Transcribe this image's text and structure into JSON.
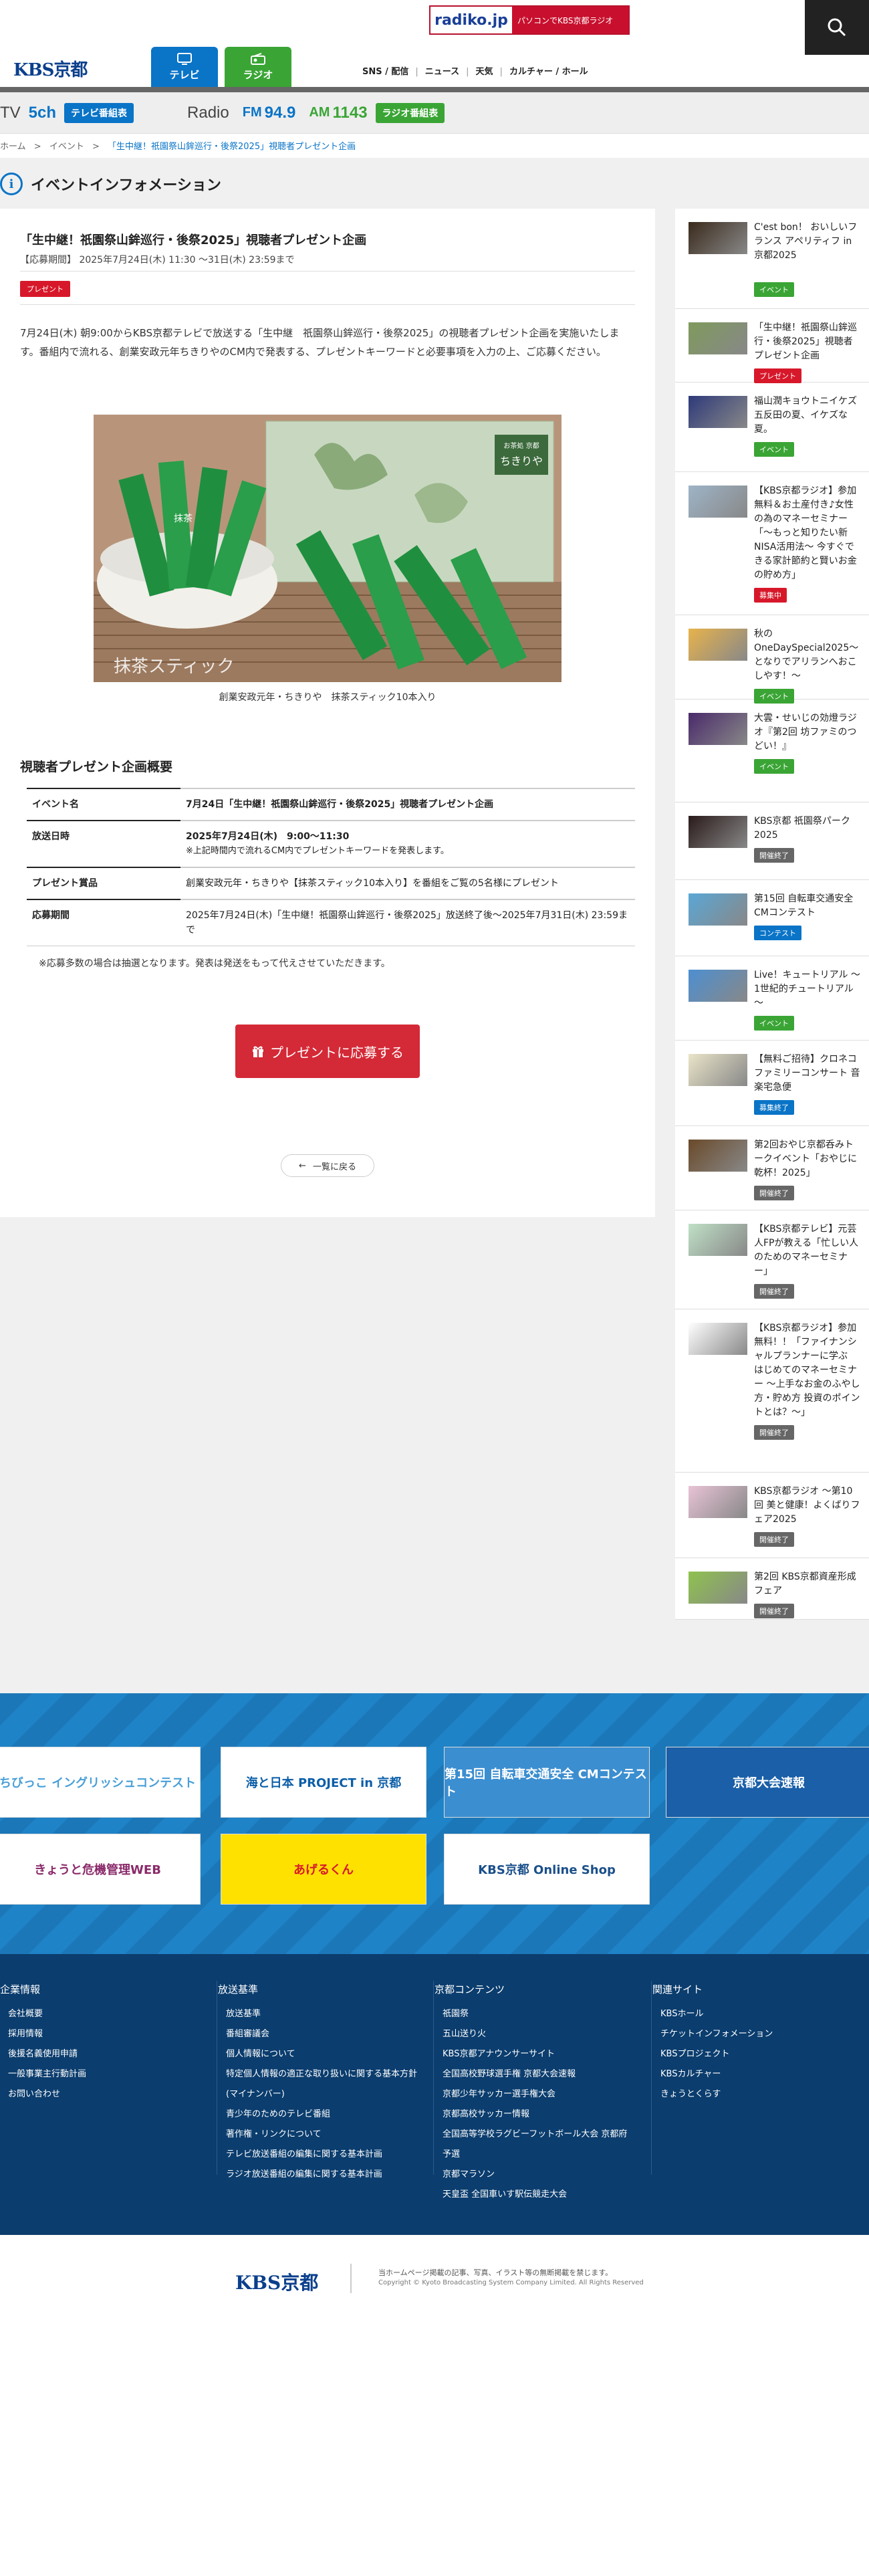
{
  "header": {
    "logo": "KBS京都",
    "radiko_logo": "radiko.jp",
    "radiko_text": "パソコンでKBS京都ラジオ",
    "tab_tv": "テレビ",
    "tab_radio": "ラジオ",
    "nav": [
      "SNS / 配信",
      "ニュース",
      "天気",
      "カルチャー / ホール"
    ]
  },
  "channels": {
    "tv_label": "TV",
    "tv_ch": "5ch",
    "tv_button": "テレビ番組表",
    "radio_label": "Radio",
    "fm_label": "FM",
    "fm_value": "94.9",
    "am_label": "AM",
    "am_value": "1143",
    "radio_button": "ラジオ番組表"
  },
  "breadcrumb": [
    "ホーム",
    "イベント",
    "「生中継！祇園祭山鉾巡行・後祭2025」視聴者プレゼント企画"
  ],
  "page_title": "イベントインフォメーション",
  "article": {
    "title": "「生中継！祇園祭山鉾巡行・後祭2025」視聴者プレゼント企画",
    "period": "【応募期間】 2025年7月24日(木) 11:30 ～31日(木) 23:59まで",
    "badge": "プレゼント",
    "body": "7月24日(木) 朝9:00からKBS京都テレビで放送する「生中継　祇園祭山鉾巡行・後祭2025」の視聴者プレゼント企画を実施いたします。番組内で流れる、創業安政元年ちきりやのCM内で発表する、プレゼントキーワードと必要事項を入力の上、ご応募ください。",
    "image_box_brand": "お茶処 京都",
    "image_box_name": "ちきりや",
    "image_overlay": "抹茶スティック",
    "stick_text": "抹茶",
    "caption": "創業安政元年・ちきりや　抹茶スティック10本入り",
    "summary_heading": "視聴者プレゼント企画概要",
    "table": [
      {
        "key": "イベント名",
        "value": "7月24日「生中継！祇園祭山鉾巡行・後祭2025」視聴者プレゼント企画",
        "sub": ""
      },
      {
        "key": "放送日時",
        "value": "2025年7月24日(木)　9:00～11:30",
        "sub": "※上記時間内で流れるCM内でプレゼントキーワードを発表します。"
      },
      {
        "key": "プレゼント賞品",
        "value": "創業安政元年・ちきりや【抹茶スティック10本入り】を番組をご覧の5名様にプレゼント",
        "sub": ""
      },
      {
        "key": "応募期間",
        "value": "2025年7月24日(木)「生中継！祇園祭山鉾巡行・後祭2025」放送終了後～2025年7月31日(木) 23:59まで",
        "sub": ""
      }
    ],
    "note": "※応募多数の場合は抽選となります。発表は発送をもって代えさせていただきます。",
    "apply_button": "プレゼントに応募する",
    "back_button": "一覧に戻る"
  },
  "sidebar": [
    {
      "title": "C'est bon！ おいしいフランス アペリティフ in 京都2025",
      "badge": "イベント",
      "badge_color": "#3aa535",
      "thumb": "#3a2a1c"
    },
    {
      "title": "「生中継！祇園祭山鉾巡行・後祭2025」視聴者プレゼント企画",
      "badge": "プレゼント",
      "badge_color": "#d7182a",
      "thumb": "#7f9a5c"
    },
    {
      "title": "福山潤キョウトニイケズ　五反田の夏、イケズな夏。",
      "badge": "イベント",
      "badge_color": "#3aa535",
      "thumb": "#2e3a7a"
    },
    {
      "title": "【KBS京都ラジオ】参加無料＆お土産付き♪女性の為のマネーセミナー「～もっと知りたい新NISA活用法～ 今すぐできる家計節約と賢いお金の貯め方」",
      "badge": "募集中",
      "badge_color": "#d7182a",
      "thumb": "#9eb4c7"
    },
    {
      "title": "秋のOneDaySpecial2025～となりでアリランへおこしやす！～",
      "badge": "イベント",
      "badge_color": "#3aa535",
      "thumb": "#e7b34c"
    },
    {
      "title": "大雲・せいじの効燈ラジオ『第2回 坊ファミのつどい！』",
      "badge": "イベント",
      "badge_color": "#3aa535",
      "thumb": "#4a2a6a"
    },
    {
      "title": "KBS京都 祇園祭パーク2025",
      "badge": "開催終了",
      "badge_color": "#666666",
      "thumb": "#2a1a1a"
    },
    {
      "title": "第15回 自転車交通安全CMコンテスト",
      "badge": "コンテスト",
      "badge_color": "#0a74c7",
      "thumb": "#5aa7d6"
    },
    {
      "title": "Live！キュートリアル ～1世紀的チュートリアル～",
      "badge": "イベント",
      "badge_color": "#3aa535",
      "thumb": "#4c8fd1"
    },
    {
      "title": "【無料ご招待】クロネコファミリーコンサート 音楽宅急便",
      "badge": "募集終了",
      "badge_color": "#0a74c7",
      "thumb": "#e9e4c8"
    },
    {
      "title": "第2回おやじ京都呑みトークイベント「おやじに乾杯！2025」",
      "badge": "開催終了",
      "badge_color": "#666666",
      "thumb": "#6a4a2a"
    },
    {
      "title": "【KBS京都テレビ】元芸人FPが教える「忙しい人のためのマネーセミナー」",
      "badge": "開催終了",
      "badge_color": "#666666",
      "thumb": "#bfe0c6"
    },
    {
      "title": "【KBS京都ラジオ】参加無料！！「ファイナンシャルプランナーに学ぶ　はじめてのマネーセミナー ～上手なお金のふやし方・貯め方 投資のポイントとは？～」",
      "badge": "開催終了",
      "badge_color": "#666666",
      "thumb": "#ffffff"
    },
    {
      "title": "KBS京都ラジオ ～第10回 美と健康！よくばりフェア2025",
      "badge": "開催終了",
      "badge_color": "#666666",
      "thumb": "#e8c3d6"
    },
    {
      "title": "第2回 KBS京都資産形成フェア",
      "badge": "開催終了",
      "badge_color": "#666666",
      "thumb": "#8fc24e"
    }
  ],
  "banners": [
    {
      "name": "ちびっこ イングリッシュコンテスト",
      "bg": "#ffffff",
      "fg": "#4a9fd8"
    },
    {
      "name": "海と日本 PROJECT in 京都",
      "bg": "#ffffff",
      "fg": "#0b5ea8"
    },
    {
      "name": "第15回 自転車交通安全 CMコンテスト",
      "bg": "#3b8ed0",
      "fg": "#ffffff"
    },
    {
      "name": "京都大会速報",
      "bg": "#1a5fa8",
      "fg": "#ffffff"
    },
    {
      "name": "きょうと危機管理WEB",
      "bg": "#ffffff",
      "fg": "#8a2a6a"
    },
    {
      "name": "あげるくん",
      "bg": "#ffe100",
      "fg": "#d7182a"
    },
    {
      "name": "KBS京都 Online Shop",
      "bg": "#ffffff",
      "fg": "#1a4f8a"
    }
  ],
  "footer": {
    "cols": [
      {
        "heading": "企業情報",
        "items": [
          "会社概要",
          "採用情報",
          "後援名義使用申請",
          "一般事業主行動計画",
          "お問い合わせ"
        ]
      },
      {
        "heading": "放送基準",
        "items": [
          "放送基準",
          "番組審議会",
          "個人情報について",
          "特定個人情報の適正な取り扱いに関する基本方針(マイナンバー)",
          "青少年のためのテレビ番組",
          "著作権・リンクについて",
          "テレビ放送番組の編集に関する基本計画",
          "ラジオ放送番組の編集に関する基本計画"
        ]
      },
      {
        "heading": "京都コンテンツ",
        "items": [
          "祇園祭",
          "五山送り火",
          "KBS京都アナウンサーサイト",
          "全国高校野球選手権 京都大会速報",
          "京都少年サッカー選手権大会",
          "京都高校サッカー情報",
          "全国高等学校ラグビーフットボール大会 京都府予選",
          "京都マラソン",
          "天皇盃 全国車いす駅伝競走大会"
        ]
      },
      {
        "heading": "関連サイト",
        "items": [
          "KBSホール",
          "チケットインフォメーション",
          "KBSプロジェクト",
          "KBSカルチャー",
          "きょうとくらす"
        ]
      }
    ],
    "logo": "KBS京都",
    "note1": "当ホームページ掲載の記事、写真、イラスト等の無断掲載を禁じます。",
    "copyright": "Copyright © Kyoto Broadcasting System Company Limited. All Rights Reserved"
  },
  "colors": {
    "tv": "#0a74c7",
    "radio": "#3aa535",
    "present": "#d7182a",
    "footer": "#0b3d6e"
  }
}
